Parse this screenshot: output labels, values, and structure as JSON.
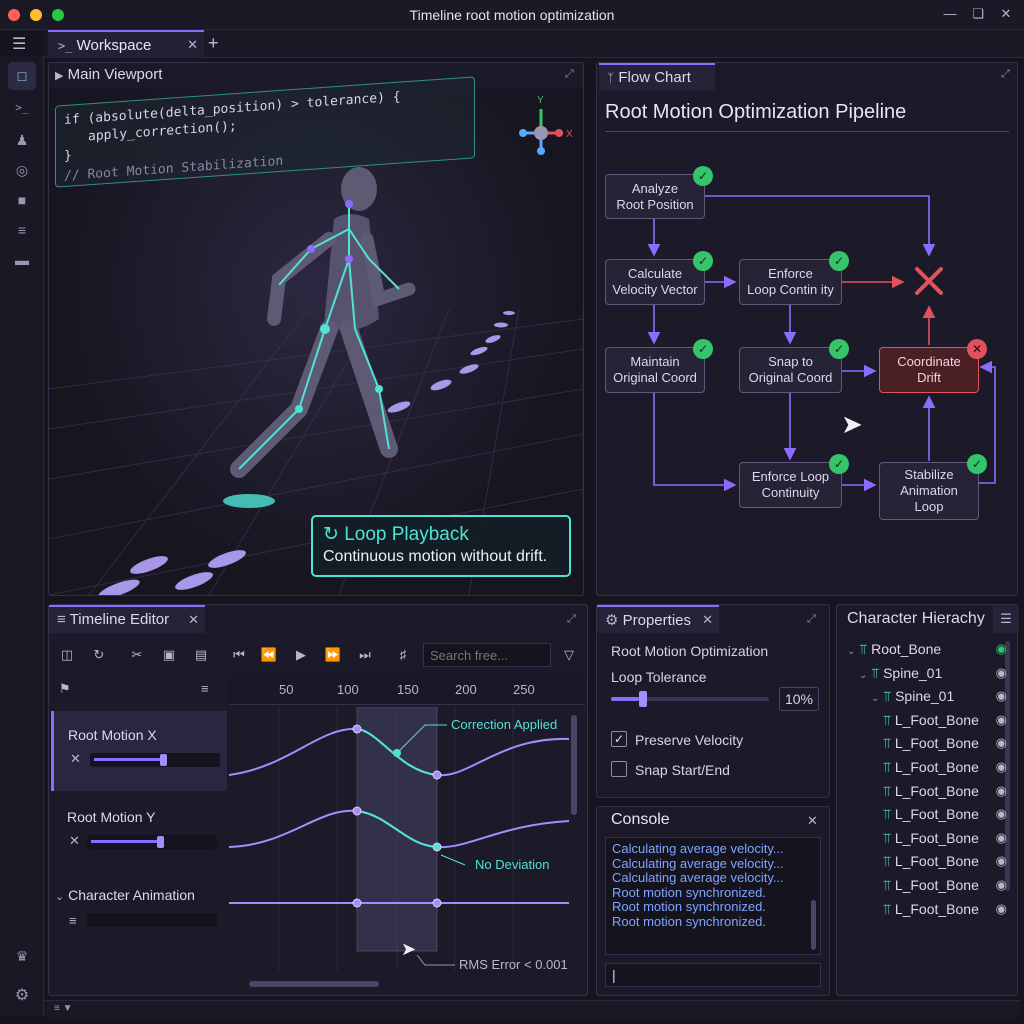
{
  "window": {
    "title": "Timeline root motion optimization"
  },
  "tabs": [
    {
      "label": "Workspace"
    }
  ],
  "viewport": {
    "title": "Main Viewport",
    "code_line1": "if (absolute(delta_position) > tolerance) {",
    "code_line2": "apply_correction();",
    "code_line3": "}",
    "code_comment": "// Root Motion Stabilization",
    "axis_y": "Y",
    "axis_x": "X",
    "callout_title": "Loop Playback",
    "callout_body": "Continuous motion without drift."
  },
  "flow": {
    "tab": "Flow Chart",
    "title": "Root Motion Optimization Pipeline",
    "nodes": {
      "analyze": [
        "Analyze",
        "Root Position"
      ],
      "calc": [
        "Calculate",
        "Velocity Vector"
      ],
      "enforce1": [
        "Enforce",
        "Loop Contin ity"
      ],
      "maintain": [
        "Maintain",
        "Original Coord"
      ],
      "snap": [
        "Snap to",
        "Original Coord"
      ],
      "coord": [
        "Coordinate",
        "Drift"
      ],
      "enforce2": [
        "Enforce Loop",
        "Continuity"
      ],
      "stabilize": [
        "Stabilize",
        "Animation",
        "Loop"
      ]
    }
  },
  "timeline": {
    "title": "Timeline Editor",
    "search_placeholder": "Search free...",
    "ruler": [
      "50",
      "100",
      "150",
      "200",
      "250"
    ],
    "tracks": [
      "Root Motion X",
      "Root Motion Y",
      "Character Animation"
    ],
    "annotations": {
      "correction": "Correction Applied",
      "no_dev": "No Deviation",
      "rms": "RMS Error < 0.001"
    },
    "slider_x": 0.6,
    "slider_y": 0.6
  },
  "properties": {
    "title": "Properties",
    "section": "Root Motion Optimization",
    "loop_tolerance_label": "Loop Tolerance",
    "loop_tolerance_value": "10%",
    "loop_tolerance_fraction": 0.1,
    "preserve_velocity": "Preserve Velocity",
    "preserve_velocity_checked": true,
    "snap_start_end": "Snap Start/End",
    "snap_start_end_checked": false
  },
  "console": {
    "title": "Console",
    "lines": [
      "Calculating average velocity...",
      "Calculating average velocity...",
      "Calculating average velocity...",
      "Root motion synchronized.",
      "Root motion synchronized.",
      "Root motion synchronized."
    ],
    "input_value": "|"
  },
  "hierarchy": {
    "title": "Character Hierachy",
    "items": [
      "Root_Bone",
      "Spine_01",
      "Spine_01",
      "L_Foot_Bone",
      "L_Foot_Bone",
      "L_Foot_Bone",
      "L_Foot_Bone",
      "L_Foot_Bone",
      "L_Foot_Bone",
      "L_Foot_Bone",
      "L_Foot_Bone",
      "L_Foot_Bone"
    ]
  },
  "colors": {
    "accent": "#8c6cff",
    "cyan": "#4fe3d6",
    "ok": "#35c46a",
    "error": "#e0525d"
  }
}
